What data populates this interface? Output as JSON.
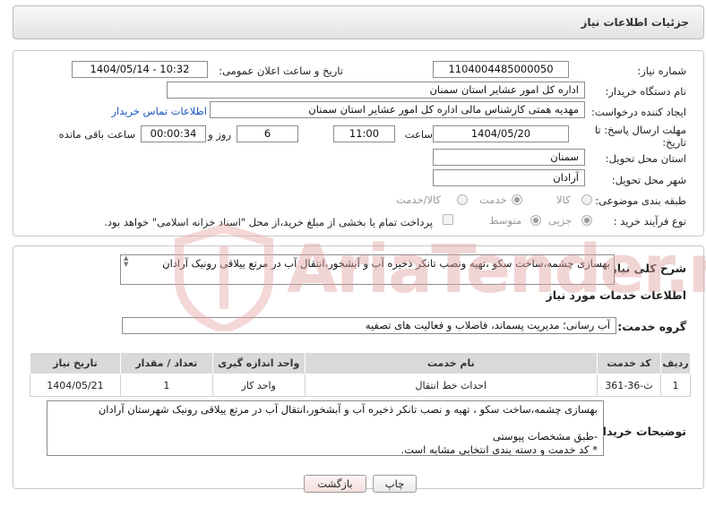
{
  "header": {
    "title": "جزئیات اطلاعات نیاز"
  },
  "form": {
    "need_number_label": "شماره نیاز:",
    "need_number": "1104004485000050",
    "announce_label": "تاریخ و ساعت اعلان عمومی:",
    "announce_value": "1404/05/14 - 10:32",
    "buyer_org_label": "نام دستگاه خریدار:",
    "buyer_org": "اداره کل امور عشایر استان سمنان",
    "requester_label": "ایجاد کننده درخواست:",
    "requester": "مهدیه همتی کارشناس مالی اداره کل امور عشایر استان سمنان",
    "contact_link": "اطلاعات تماس خریدار",
    "deadline_label_line1": "مهلت ارسال پاسخ: تا",
    "deadline_label_line2": "تاریخ:",
    "deadline_date": "1404/05/20",
    "time_label": "ساعت",
    "deadline_time": "11:00",
    "days_value": "6",
    "days_label": "روز و",
    "remaining_time": "00:00:34",
    "remaining_label": "ساعت باقی مانده",
    "province_label": "استان محل تحویل:",
    "province": "سمنان",
    "city_label": "شهر محل تحویل:",
    "city": "آرادان",
    "category_label": "طبقه بندی موضوعی:",
    "category_options": [
      "کالا",
      "خدمت",
      "کالا/خدمت"
    ],
    "category_selected": "خدمت",
    "process_label": "نوع فرآیند خرید :",
    "process_options": [
      "جزیی",
      "متوسط"
    ],
    "process_selected": "جزیی",
    "payment_note": "پرداخت تمام یا بخشی از مبلغ خرید،از محل \"اسناد خزانه اسلامی\" خواهد بود."
  },
  "summary": {
    "label": "شرح کلی نیاز:",
    "text": "بهسازی چشمه،ساخت سکو ،تهیه ونصب تانکر ذخیره آب و آبشخور،انتقال آب در مرتع ییلاقی رونیک آرادان"
  },
  "services": {
    "section_title": "اطلاعات خدمات مورد نیاز",
    "group_label": "گروه خدمت:",
    "group_value": "آب رسانی؛ مدیریت پسماند، فاضلاب و فعالیت های تصفیه",
    "columns": [
      "ردیف",
      "کد خدمت",
      "نام خدمت",
      "واحد اندازه گیری",
      "تعداد / مقدار",
      "تاریخ نیاز"
    ],
    "rows": [
      {
        "row": "1",
        "code": "ث-36-361",
        "name": "احداث خط انتقال",
        "unit": "واحد کار",
        "qty": "1",
        "date": "1404/05/21"
      }
    ]
  },
  "buyer_notes": {
    "label": "توضیحات خریدار:",
    "line1": "بهسازی چشمه،ساخت سکو ، تهیه و نصب تانکر ذخیره آب و آبشخور،انتقال آب در مرتع ییلاقی رونیک شهرستان آرادان",
    "line2": "-طبق مشخصات پیوستی",
    "line3": "* کد خدمت و دسته بندی انتخابی مشابه است."
  },
  "buttons": {
    "print": "چاپ",
    "back": "بازگشت"
  },
  "watermark": {
    "text": "AriaTender.net"
  },
  "colors": {
    "link": "#1a55c2",
    "header_bg": "#e6e6e6",
    "table_header": "#d9d9d9",
    "watermark": "#f2c7c7"
  }
}
